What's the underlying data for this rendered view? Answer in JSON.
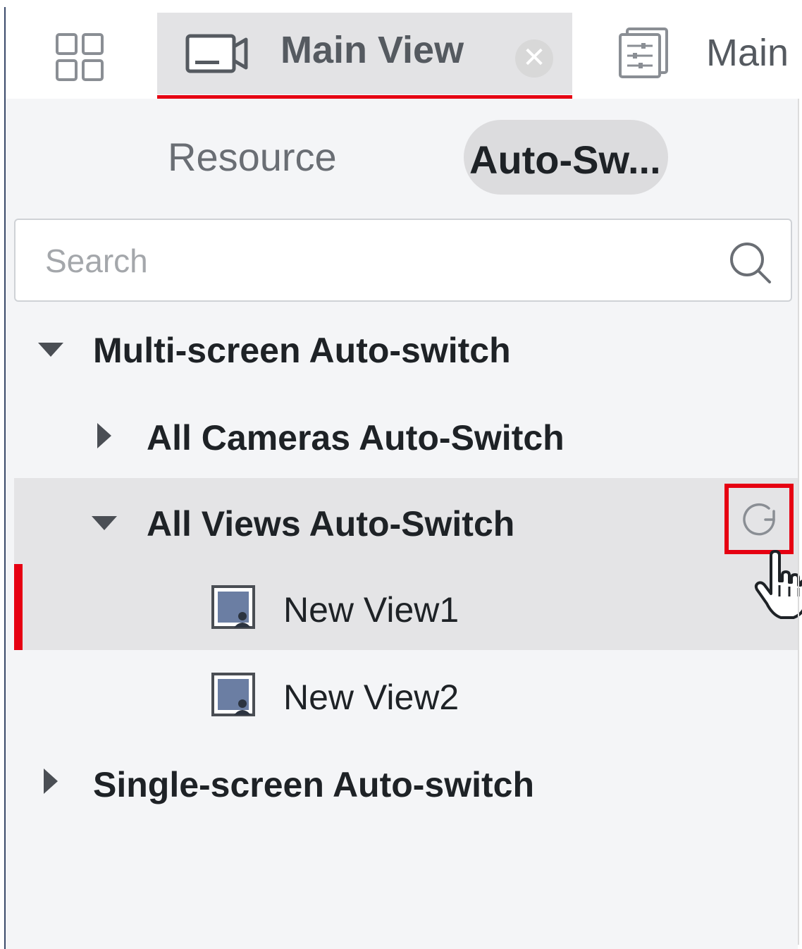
{
  "tabs": {
    "main_view_label": "Main View",
    "close_symbol": "✕",
    "second_tab_label": "Main"
  },
  "panel": {
    "segments": {
      "resource": "Resource",
      "auto_switch": "Auto-Sw..."
    },
    "search": {
      "placeholder": "Search",
      "value": ""
    },
    "tree": {
      "multi": "Multi-screen Auto-switch",
      "all_cameras": "All Cameras Auto-Switch",
      "all_views": "All Views Auto-Switch",
      "view1": "New View1",
      "view2": "New View2",
      "single": "Single-screen Auto-switch"
    }
  },
  "icons": {
    "grid": "grid-icon",
    "camera": "camera-icon",
    "close": "close-icon",
    "settings_doc": "settings-doc-icon",
    "search": "search-icon",
    "view": "view-icon",
    "auto_switch": "refresh-icon",
    "cursor": "hand-cursor-icon"
  },
  "colors": {
    "accent": "#e60012",
    "selected_row": "#e4e4e6",
    "panel_bg": "#f4f5f7"
  }
}
